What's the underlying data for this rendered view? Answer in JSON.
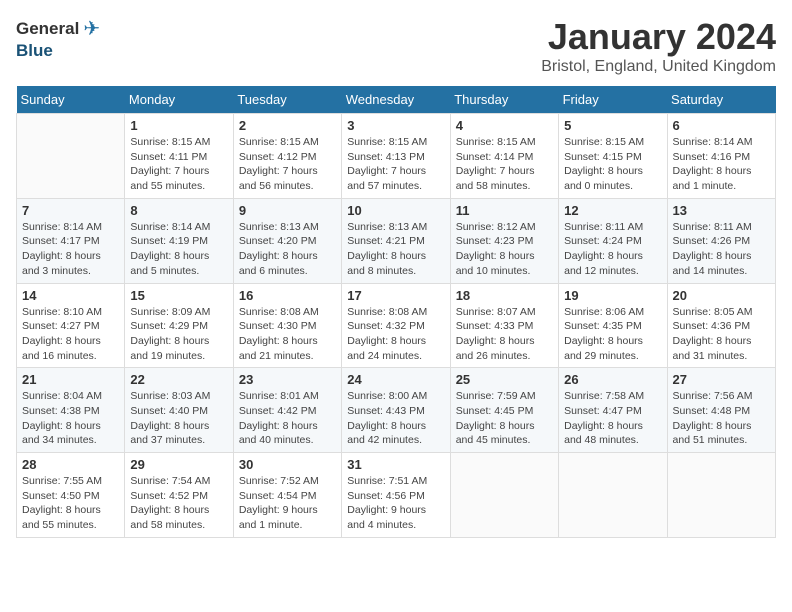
{
  "header": {
    "logo_general": "General",
    "logo_blue": "Blue",
    "month_title": "January 2024",
    "location": "Bristol, England, United Kingdom"
  },
  "weekdays": [
    "Sunday",
    "Monday",
    "Tuesday",
    "Wednesday",
    "Thursday",
    "Friday",
    "Saturday"
  ],
  "weeks": [
    [
      {
        "day": "",
        "sunrise": "",
        "sunset": "",
        "daylight": ""
      },
      {
        "day": "1",
        "sunrise": "Sunrise: 8:15 AM",
        "sunset": "Sunset: 4:11 PM",
        "daylight": "Daylight: 7 hours and 55 minutes."
      },
      {
        "day": "2",
        "sunrise": "Sunrise: 8:15 AM",
        "sunset": "Sunset: 4:12 PM",
        "daylight": "Daylight: 7 hours and 56 minutes."
      },
      {
        "day": "3",
        "sunrise": "Sunrise: 8:15 AM",
        "sunset": "Sunset: 4:13 PM",
        "daylight": "Daylight: 7 hours and 57 minutes."
      },
      {
        "day": "4",
        "sunrise": "Sunrise: 8:15 AM",
        "sunset": "Sunset: 4:14 PM",
        "daylight": "Daylight: 7 hours and 58 minutes."
      },
      {
        "day": "5",
        "sunrise": "Sunrise: 8:15 AM",
        "sunset": "Sunset: 4:15 PM",
        "daylight": "Daylight: 8 hours and 0 minutes."
      },
      {
        "day": "6",
        "sunrise": "Sunrise: 8:14 AM",
        "sunset": "Sunset: 4:16 PM",
        "daylight": "Daylight: 8 hours and 1 minute."
      }
    ],
    [
      {
        "day": "7",
        "sunrise": "Sunrise: 8:14 AM",
        "sunset": "Sunset: 4:17 PM",
        "daylight": "Daylight: 8 hours and 3 minutes."
      },
      {
        "day": "8",
        "sunrise": "Sunrise: 8:14 AM",
        "sunset": "Sunset: 4:19 PM",
        "daylight": "Daylight: 8 hours and 5 minutes."
      },
      {
        "day": "9",
        "sunrise": "Sunrise: 8:13 AM",
        "sunset": "Sunset: 4:20 PM",
        "daylight": "Daylight: 8 hours and 6 minutes."
      },
      {
        "day": "10",
        "sunrise": "Sunrise: 8:13 AM",
        "sunset": "Sunset: 4:21 PM",
        "daylight": "Daylight: 8 hours and 8 minutes."
      },
      {
        "day": "11",
        "sunrise": "Sunrise: 8:12 AM",
        "sunset": "Sunset: 4:23 PM",
        "daylight": "Daylight: 8 hours and 10 minutes."
      },
      {
        "day": "12",
        "sunrise": "Sunrise: 8:11 AM",
        "sunset": "Sunset: 4:24 PM",
        "daylight": "Daylight: 8 hours and 12 minutes."
      },
      {
        "day": "13",
        "sunrise": "Sunrise: 8:11 AM",
        "sunset": "Sunset: 4:26 PM",
        "daylight": "Daylight: 8 hours and 14 minutes."
      }
    ],
    [
      {
        "day": "14",
        "sunrise": "Sunrise: 8:10 AM",
        "sunset": "Sunset: 4:27 PM",
        "daylight": "Daylight: 8 hours and 16 minutes."
      },
      {
        "day": "15",
        "sunrise": "Sunrise: 8:09 AM",
        "sunset": "Sunset: 4:29 PM",
        "daylight": "Daylight: 8 hours and 19 minutes."
      },
      {
        "day": "16",
        "sunrise": "Sunrise: 8:08 AM",
        "sunset": "Sunset: 4:30 PM",
        "daylight": "Daylight: 8 hours and 21 minutes."
      },
      {
        "day": "17",
        "sunrise": "Sunrise: 8:08 AM",
        "sunset": "Sunset: 4:32 PM",
        "daylight": "Daylight: 8 hours and 24 minutes."
      },
      {
        "day": "18",
        "sunrise": "Sunrise: 8:07 AM",
        "sunset": "Sunset: 4:33 PM",
        "daylight": "Daylight: 8 hours and 26 minutes."
      },
      {
        "day": "19",
        "sunrise": "Sunrise: 8:06 AM",
        "sunset": "Sunset: 4:35 PM",
        "daylight": "Daylight: 8 hours and 29 minutes."
      },
      {
        "day": "20",
        "sunrise": "Sunrise: 8:05 AM",
        "sunset": "Sunset: 4:36 PM",
        "daylight": "Daylight: 8 hours and 31 minutes."
      }
    ],
    [
      {
        "day": "21",
        "sunrise": "Sunrise: 8:04 AM",
        "sunset": "Sunset: 4:38 PM",
        "daylight": "Daylight: 8 hours and 34 minutes."
      },
      {
        "day": "22",
        "sunrise": "Sunrise: 8:03 AM",
        "sunset": "Sunset: 4:40 PM",
        "daylight": "Daylight: 8 hours and 37 minutes."
      },
      {
        "day": "23",
        "sunrise": "Sunrise: 8:01 AM",
        "sunset": "Sunset: 4:42 PM",
        "daylight": "Daylight: 8 hours and 40 minutes."
      },
      {
        "day": "24",
        "sunrise": "Sunrise: 8:00 AM",
        "sunset": "Sunset: 4:43 PM",
        "daylight": "Daylight: 8 hours and 42 minutes."
      },
      {
        "day": "25",
        "sunrise": "Sunrise: 7:59 AM",
        "sunset": "Sunset: 4:45 PM",
        "daylight": "Daylight: 8 hours and 45 minutes."
      },
      {
        "day": "26",
        "sunrise": "Sunrise: 7:58 AM",
        "sunset": "Sunset: 4:47 PM",
        "daylight": "Daylight: 8 hours and 48 minutes."
      },
      {
        "day": "27",
        "sunrise": "Sunrise: 7:56 AM",
        "sunset": "Sunset: 4:48 PM",
        "daylight": "Daylight: 8 hours and 51 minutes."
      }
    ],
    [
      {
        "day": "28",
        "sunrise": "Sunrise: 7:55 AM",
        "sunset": "Sunset: 4:50 PM",
        "daylight": "Daylight: 8 hours and 55 minutes."
      },
      {
        "day": "29",
        "sunrise": "Sunrise: 7:54 AM",
        "sunset": "Sunset: 4:52 PM",
        "daylight": "Daylight: 8 hours and 58 minutes."
      },
      {
        "day": "30",
        "sunrise": "Sunrise: 7:52 AM",
        "sunset": "Sunset: 4:54 PM",
        "daylight": "Daylight: 9 hours and 1 minute."
      },
      {
        "day": "31",
        "sunrise": "Sunrise: 7:51 AM",
        "sunset": "Sunset: 4:56 PM",
        "daylight": "Daylight: 9 hours and 4 minutes."
      },
      {
        "day": "",
        "sunrise": "",
        "sunset": "",
        "daylight": ""
      },
      {
        "day": "",
        "sunrise": "",
        "sunset": "",
        "daylight": ""
      },
      {
        "day": "",
        "sunrise": "",
        "sunset": "",
        "daylight": ""
      }
    ]
  ]
}
